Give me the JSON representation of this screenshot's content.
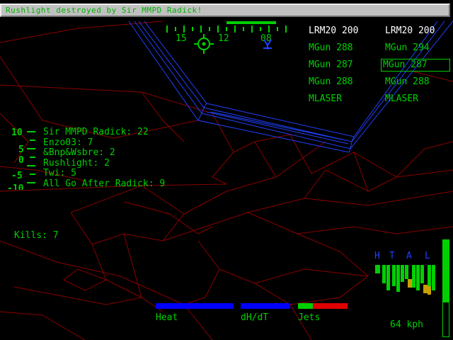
{
  "message_bar": {
    "text": "Rushlight destroyed by Sir MMPD Radick!"
  },
  "compass": {
    "ticks": [
      "15",
      "12",
      "08"
    ]
  },
  "weapons_left": [
    {
      "label": "LRM20 200",
      "color": "#ffffff"
    },
    {
      "label": "MGun 288",
      "color": "#00d000"
    },
    {
      "label": "MGun 287",
      "color": "#00d000"
    },
    {
      "label": "MGun 288",
      "color": "#00d000"
    },
    {
      "label": "MLASER",
      "color": "#00d000"
    }
  ],
  "weapons_right": [
    {
      "label": "LRM20 200",
      "color": "#ffffff"
    },
    {
      "label": "MGun 294",
      "color": "#00d000"
    },
    {
      "label": "MGun 287",
      "color": "#00d000",
      "selected": true
    },
    {
      "label": "MGun 288",
      "color": "#00d000"
    },
    {
      "label": "MLASER",
      "color": "#00d000"
    }
  ],
  "scoreboard": [
    "Sir MMPD Radick: 22",
    "Enzo03: 7",
    "&Bnp&Wsbre: 2",
    "Rushlight: 2",
    "Twi: 5",
    "All Go After Radick: 9"
  ],
  "pitch_ladder": [
    "10",
    "5",
    "0",
    "-5",
    "-10"
  ],
  "kills": "Kills: 7",
  "gauges": {
    "heat_label": "Heat",
    "dhdt_label": "dH/dT",
    "jets_label": "Jets",
    "jets_fraction": 0.3
  },
  "speed": "64 kph",
  "damage_display": {
    "labels": [
      "H",
      "T",
      "A",
      "L"
    ]
  },
  "colors": {
    "hud": "#00d000",
    "wire": "#2040ff",
    "terrain": "#8a0000",
    "heat": "#0000ff",
    "jets_full": "#00d000",
    "jets_empty": "#e00000"
  }
}
